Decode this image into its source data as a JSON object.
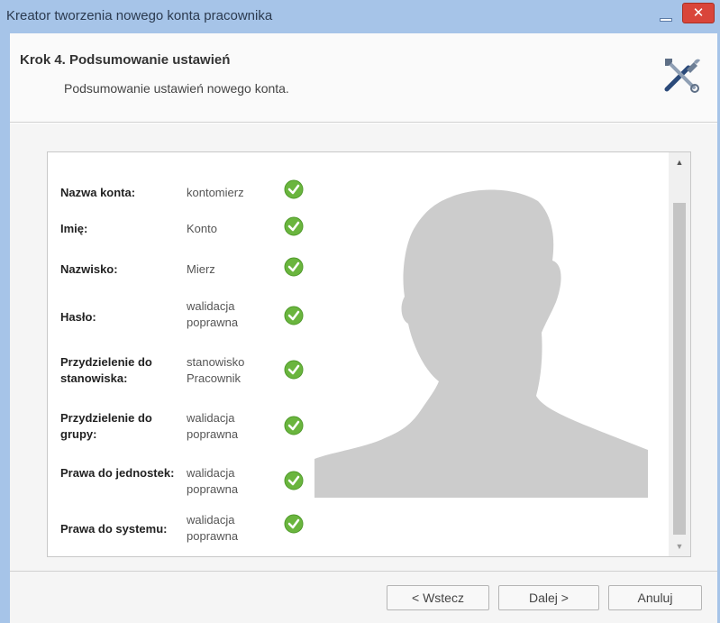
{
  "window": {
    "title": "Kreator tworzenia nowego konta pracownika",
    "close_glyph": "✕"
  },
  "header": {
    "step_title": "Krok 4. Podsumowanie ustawień",
    "step_subtitle": "Podsumowanie ustawień nowego konta."
  },
  "summary": {
    "rows": [
      {
        "label": "Nazwa konta:",
        "value": "kontomierz",
        "status": "valid"
      },
      {
        "label": "Imię:",
        "value": "Konto",
        "status": "valid"
      },
      {
        "label": "Nazwisko:",
        "value": "Mierz",
        "status": "valid"
      },
      {
        "label": "Hasło:",
        "value": "walidacja poprawna",
        "status": "valid"
      },
      {
        "label": "Przydzielenie do stanowiska:",
        "value": "stanowisko Pracownik",
        "status": "valid"
      },
      {
        "label": "Przydzielenie do grupy:",
        "value": "walidacja poprawna",
        "status": "valid"
      },
      {
        "label": "Prawa do jednostek:",
        "value": "walidacja poprawna",
        "status": "valid"
      },
      {
        "label": "Prawa do systemu:",
        "value": "walidacja poprawna",
        "status": "valid"
      }
    ]
  },
  "scrollbar": {
    "up_glyph": "▲",
    "down_glyph": "▼"
  },
  "footer": {
    "back_label": "< Wstecz",
    "next_label": "Dalej >",
    "cancel_label": "Anuluj"
  },
  "colors": {
    "accent": "#a6c4e8",
    "check": "#6ab53e",
    "silhouette": "#cccccc"
  }
}
